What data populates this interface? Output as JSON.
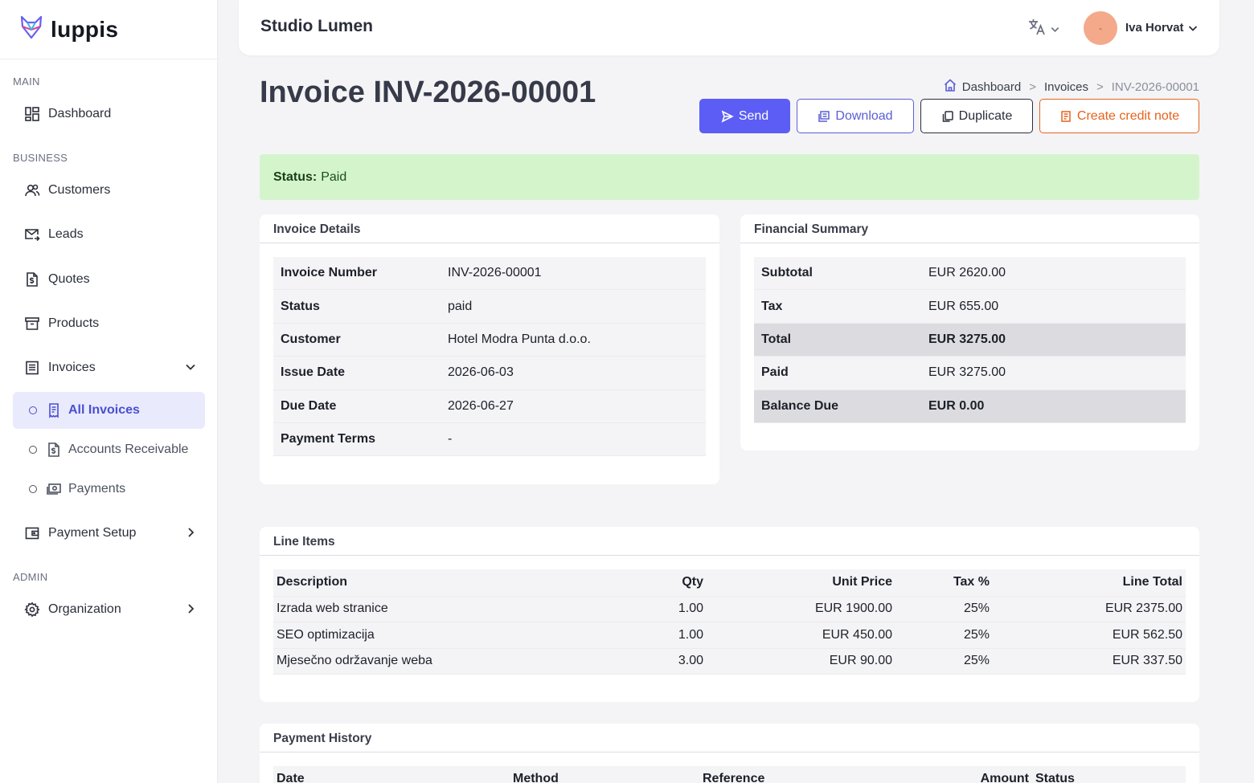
{
  "brand": {
    "name": "luppis"
  },
  "sidebar": {
    "sections": {
      "main": "MAIN",
      "business": "BUSINESS",
      "admin": "ADMIN"
    },
    "items": {
      "dashboard": "Dashboard",
      "customers": "Customers",
      "leads": "Leads",
      "quotes": "Quotes",
      "products": "Products",
      "invoices": "Invoices",
      "all_invoices": "All Invoices",
      "accounts_receivable": "Accounts Receivable",
      "payments": "Payments",
      "payment_setup": "Payment Setup",
      "organization": "Organization"
    }
  },
  "header": {
    "org_name": "Studio Lumen",
    "avatar_initial": "-",
    "user_name": "Iva Horvat"
  },
  "page": {
    "title": "Invoice INV-2026-00001",
    "breadcrumb": {
      "home": "Dashboard",
      "parent": "Invoices",
      "current": "INV-2026-00001"
    },
    "buttons": {
      "send": "Send",
      "download": "Download",
      "duplicate": "Duplicate",
      "credit_note": "Create credit note"
    },
    "status_label": "Status:",
    "status_value": "Paid"
  },
  "invoice_details": {
    "title": "Invoice Details",
    "rows": [
      {
        "label": "Invoice Number",
        "value": "INV-2026-00001"
      },
      {
        "label": "Status",
        "value": "paid"
      },
      {
        "label": "Customer",
        "value": "Hotel Modra Punta d.o.o."
      },
      {
        "label": "Issue Date",
        "value": "2026-06-03"
      },
      {
        "label": "Due Date",
        "value": "2026-06-27"
      },
      {
        "label": "Payment Terms",
        "value": "-"
      }
    ]
  },
  "financial_summary": {
    "title": "Financial Summary",
    "rows": [
      {
        "label": "Subtotal",
        "value": "EUR 2620.00"
      },
      {
        "label": "Tax",
        "value": "EUR 655.00"
      },
      {
        "label": "Total",
        "value": "EUR 3275.00"
      },
      {
        "label": "Paid",
        "value": "EUR 3275.00"
      },
      {
        "label": "Balance Due",
        "value": "EUR 0.00"
      }
    ]
  },
  "line_items": {
    "title": "Line Items",
    "columns": [
      "Description",
      "Qty",
      "Unit Price",
      "Tax %",
      "Line Total"
    ],
    "rows": [
      [
        "Izrada web stranice",
        "1.00",
        "EUR 1900.00",
        "25%",
        "EUR 2375.00"
      ],
      [
        "SEO optimizacija",
        "1.00",
        "EUR 450.00",
        "25%",
        "EUR 562.50"
      ],
      [
        "Mjesečno održavanje weba",
        "3.00",
        "EUR 90.00",
        "25%",
        "EUR 337.50"
      ]
    ]
  },
  "payment_history": {
    "title": "Payment History",
    "columns": [
      "Date",
      "Method",
      "Reference",
      "Amount",
      "Status"
    ]
  },
  "colors": {
    "primary": "#5b5df5",
    "credit": "#e6631c",
    "status_bg": "#d4f5cc"
  }
}
